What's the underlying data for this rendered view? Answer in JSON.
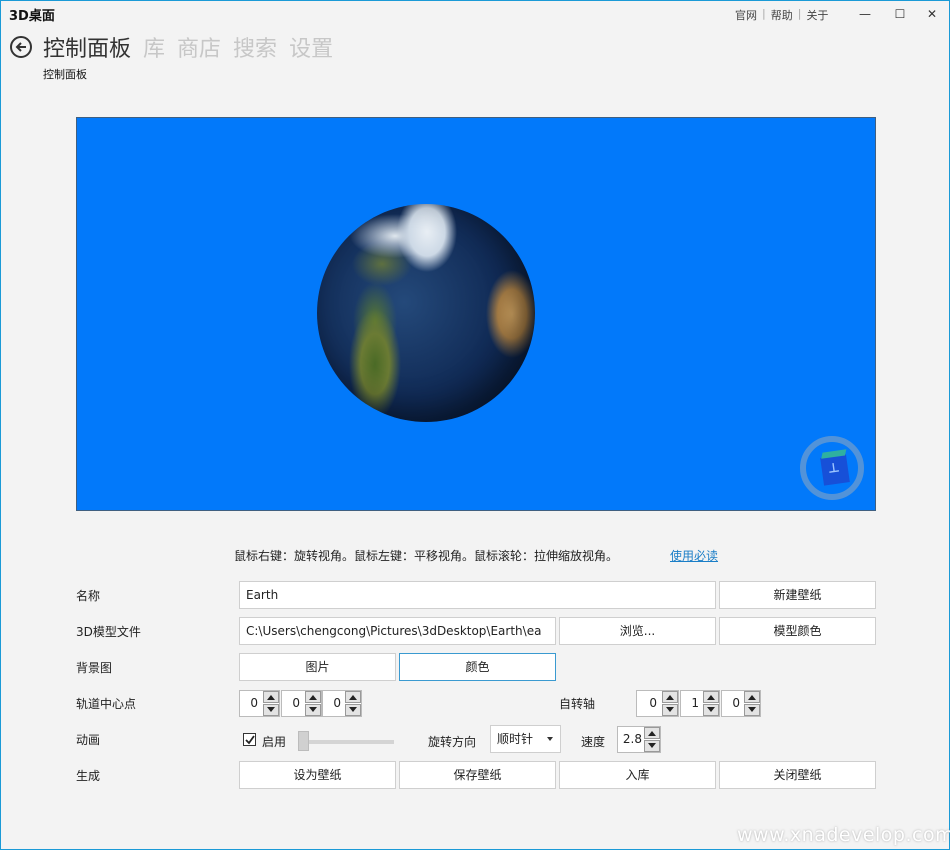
{
  "window": {
    "title": "3D桌面",
    "links": [
      "官网",
      "帮助",
      "关于"
    ],
    "controls": {
      "minimize": "—",
      "maximize": "☐",
      "close": "✕"
    }
  },
  "nav": {
    "tabs": [
      "控制面板",
      "库",
      "商店",
      "搜索",
      "设置"
    ],
    "active": "控制面板",
    "breadcrumb": "控制面板"
  },
  "preview": {
    "background_color": "#0279fa",
    "hint": "鼠标右键：旋转视角。鼠标左键：平移视角。鼠标滚轮：拉伸缩放视角。",
    "hint_link": "使用必读"
  },
  "form": {
    "name": {
      "label": "名称",
      "value": "Earth",
      "button": "新建壁纸"
    },
    "model_file": {
      "label": "3D模型文件",
      "value": "C:\\Users\\chengcong\\Pictures\\3dDesktop\\Earth\\ea",
      "browse": "浏览...",
      "model_color": "模型颜色"
    },
    "background": {
      "label": "背景图",
      "image_button": "图片",
      "color_button": "颜色"
    },
    "orbit_center": {
      "label": "轨道中心点",
      "values": [
        "0",
        "0",
        "0"
      ]
    },
    "rotation_axis": {
      "label": "自转轴",
      "values": [
        "0",
        "1",
        "0"
      ]
    },
    "animation": {
      "label": "动画",
      "enable_label": "启用",
      "enabled": true,
      "direction_label": "旋转方向",
      "direction_value": "顺时针",
      "speed_label": "速度",
      "speed_value": "2.8"
    },
    "generate": {
      "label": "生成",
      "buttons": [
        "设为壁纸",
        "保存壁纸",
        "入库",
        "关闭壁纸"
      ]
    }
  },
  "watermark": "www.xnadevelop.com"
}
